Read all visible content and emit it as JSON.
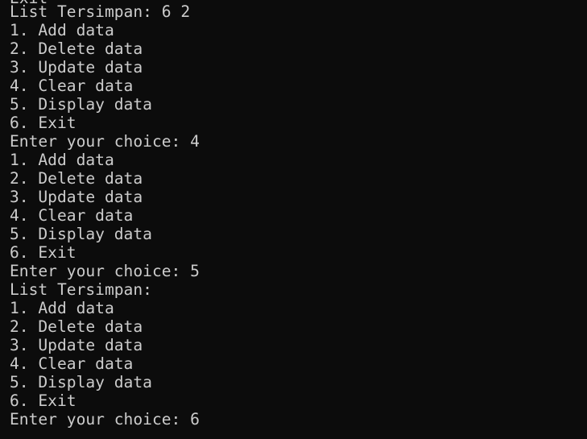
{
  "terminal": {
    "partial_top_line": "Exit",
    "lines": [
      "List Tersimpan: 6 2",
      "1. Add data",
      "2. Delete data",
      "3. Update data",
      "4. Clear data",
      "5. Display data",
      "6. Exit",
      "Enter your choice: 4",
      "1. Add data",
      "2. Delete data",
      "3. Update data",
      "4. Clear data",
      "5. Display data",
      "6. Exit",
      "Enter your choice: 5",
      "List Tersimpan:",
      "1. Add data",
      "2. Delete data",
      "3. Update data",
      "4. Clear data",
      "5. Display data",
      "6. Exit",
      "Enter your choice: 6"
    ]
  }
}
